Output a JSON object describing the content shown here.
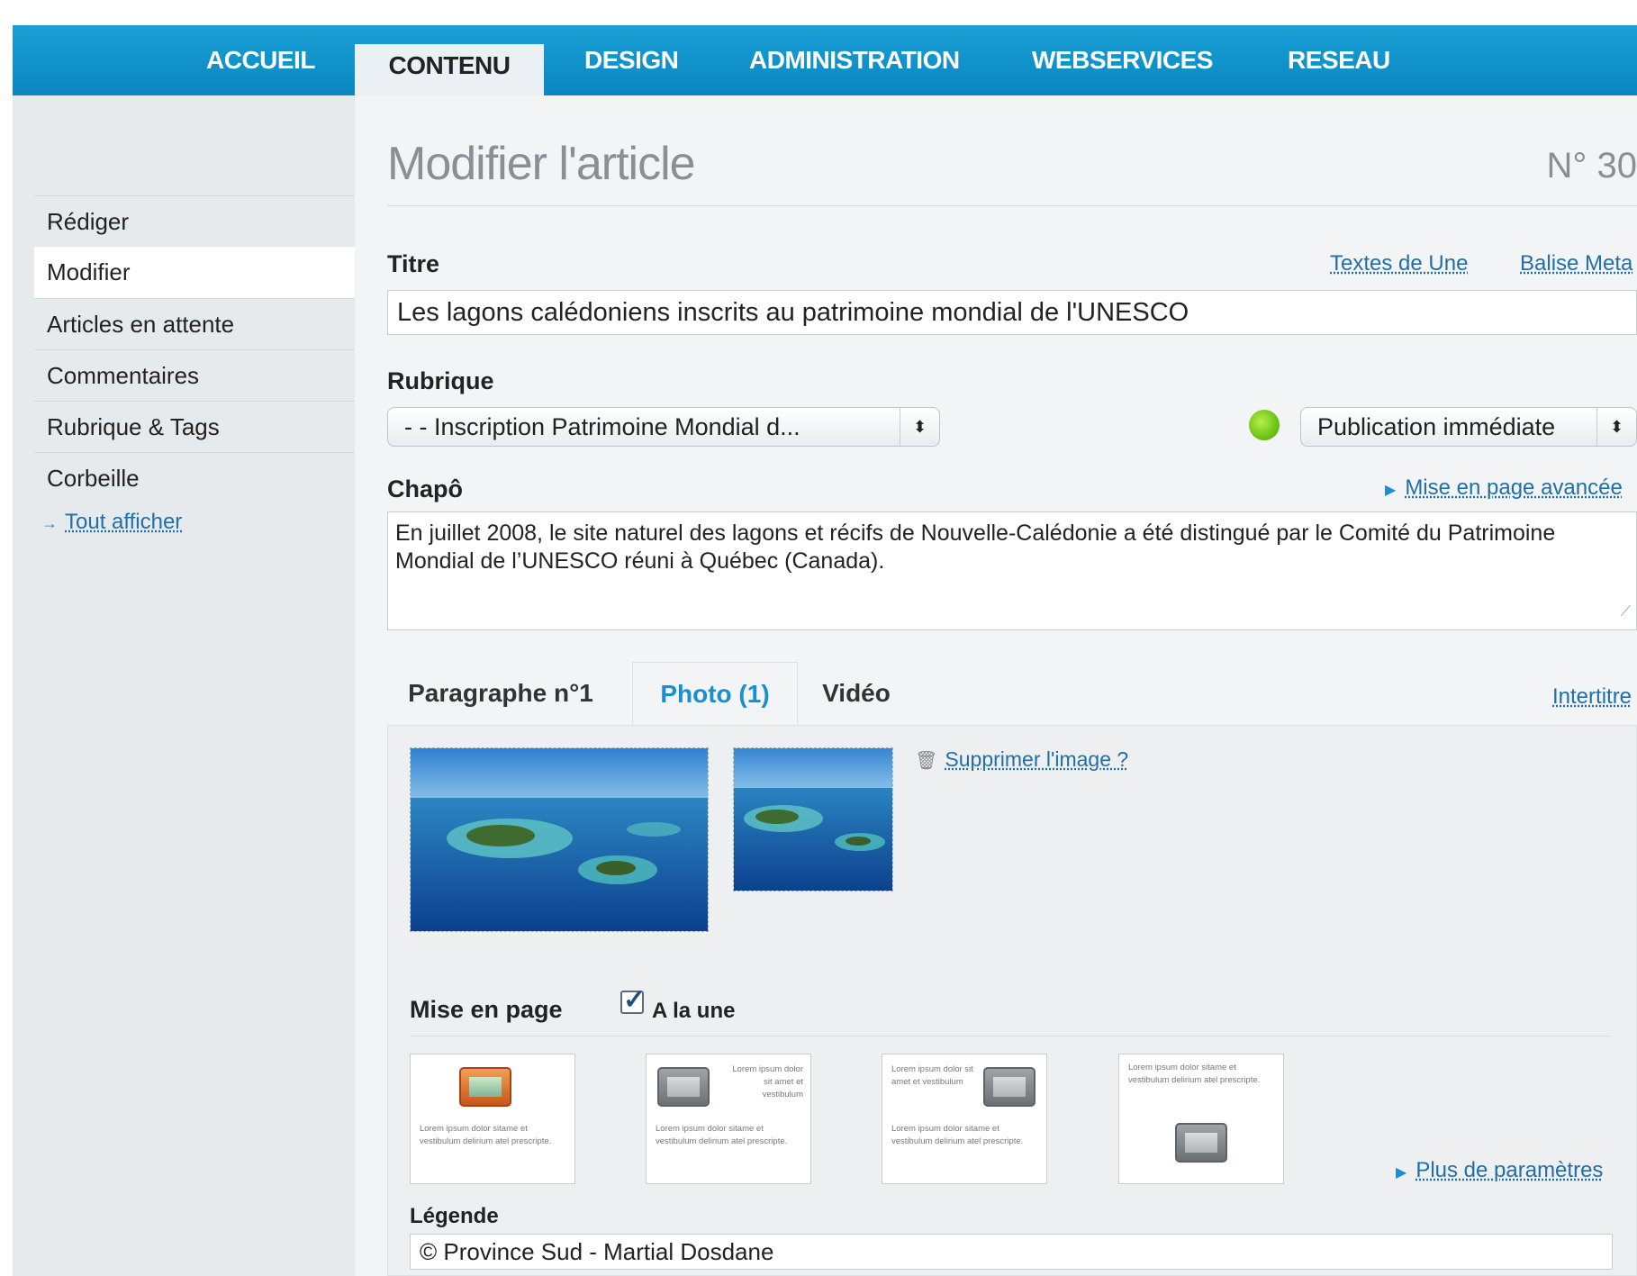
{
  "nav": {
    "items": [
      "ACCUEIL",
      "CONTENU",
      "DESIGN",
      "ADMINISTRATION",
      "WEBSERVICES",
      "RESEAU"
    ],
    "active": "CONTENU"
  },
  "sidebar": {
    "items": [
      "Rédiger",
      "Modifier",
      "Articles en attente",
      "Commentaires",
      "Rubrique & Tags",
      "Corbeille"
    ],
    "active": "Modifier",
    "show_all": "Tout afficher"
  },
  "page": {
    "title": "Modifier l'article",
    "number": "N° 30"
  },
  "titre": {
    "label": "Titre",
    "links": [
      "Textes de Une",
      "Balise Meta"
    ],
    "value": "Les lagons calédoniens inscrits au patrimoine mondial de l'UNESCO"
  },
  "rubrique": {
    "label": "Rubrique",
    "selected": "- - Inscription Patrimoine Mondial d...",
    "publication": "Publication immédiate",
    "status_color": "#6cc414"
  },
  "chapo": {
    "label": "Chapô",
    "advanced_link": "Mise en page avancée",
    "value": "En juillet 2008, le site naturel des lagons et récifs de Nouvelle-Calédonie a été distingué par le Comité du Patrimoine Mondial de l’UNESCO réuni à Québec (Canada)."
  },
  "tabs": {
    "items": [
      "Paragraphe n°1",
      "Photo (1)",
      "Vidéo"
    ],
    "active": "Photo (1)",
    "intertitre": "Intertitre"
  },
  "photo": {
    "delete_link": "Supprimer l'image ?",
    "layout_label": "Mise en page",
    "a_la_une_label": "A la une",
    "a_la_une_checked": true,
    "lorem_a": "Lorem ipsum dolor sitame et vestibulum delirium atel prescripte.",
    "lorem_b": "Lorem ipsum dolor sit amet et vestibulum",
    "lorem_c": "Lorem ipsum dolor sitame et vestibulum delirium atel prescripte.",
    "more_params": "Plus de paramètres",
    "legend_label": "Légende",
    "legend_value": "© Province Sud - Martial Dosdane"
  },
  "colors": {
    "accent": "#1a8fd0",
    "nav_bar": "#0a86c0",
    "link": "#1f6fa8"
  }
}
